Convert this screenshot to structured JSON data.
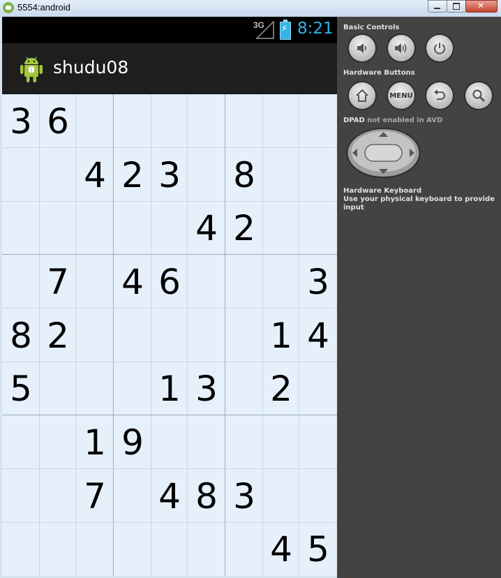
{
  "window": {
    "title": "5554:android"
  },
  "device": {
    "network_label": "3G",
    "clock": "8:21",
    "app_title": "shudu08"
  },
  "sudoku": {
    "rows": [
      [
        "3",
        "6",
        "",
        "",
        "",
        "",
        "",
        "",
        ""
      ],
      [
        "",
        "",
        "4",
        "2",
        "3",
        "",
        "8",
        "",
        ""
      ],
      [
        "",
        "",
        "",
        "",
        "",
        "4",
        "2",
        "",
        ""
      ],
      [
        "",
        "7",
        "",
        "4",
        "6",
        "",
        "",
        "",
        "3"
      ],
      [
        "8",
        "2",
        "",
        "",
        "",
        "",
        "",
        "1",
        "4"
      ],
      [
        "5",
        "",
        "",
        "",
        "1",
        "3",
        "",
        "2",
        ""
      ],
      [
        "",
        "",
        "1",
        "9",
        "",
        "",
        "",
        "",
        ""
      ],
      [
        "",
        "",
        "7",
        "",
        "4",
        "8",
        "3",
        "",
        ""
      ],
      [
        "",
        "",
        "",
        "",
        "",
        "",
        "",
        "4",
        "5"
      ]
    ]
  },
  "controls": {
    "basic_title": "Basic Controls",
    "hardware_title": "Hardware Buttons",
    "menu_label": "MENU",
    "dpad_prefix": "DPAD",
    "dpad_note": "not enabled in AVD",
    "keyboard_title": "Hardware Keyboard",
    "keyboard_note": "Use your physical keyboard to provide input",
    "icons": [
      "volume-down-icon",
      "volume-up-icon",
      "power-icon",
      "home-icon",
      "menu-icon",
      "back-icon",
      "search-icon"
    ]
  }
}
